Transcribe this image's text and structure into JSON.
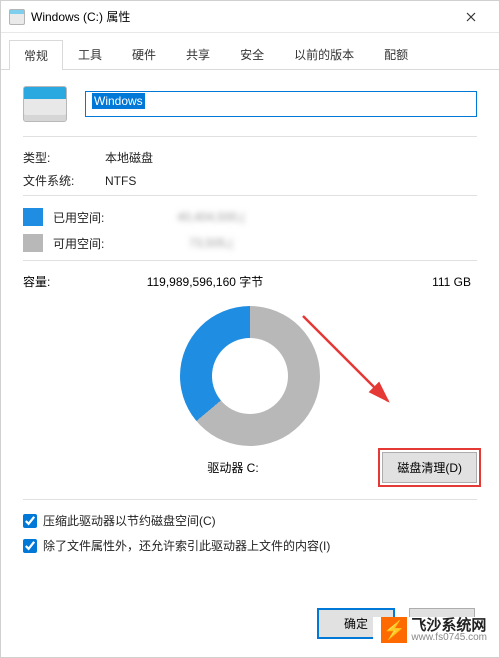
{
  "titlebar": {
    "title": "Windows (C:) 属性"
  },
  "tabs": [
    {
      "label": "常规",
      "active": true
    },
    {
      "label": "工具",
      "active": false
    },
    {
      "label": "硬件",
      "active": false
    },
    {
      "label": "共享",
      "active": false
    },
    {
      "label": "安全",
      "active": false
    },
    {
      "label": "以前的版本",
      "active": false
    },
    {
      "label": "配额",
      "active": false
    }
  ],
  "drive": {
    "name_value": "Windows",
    "type_label": "类型:",
    "type_value": "本地磁盘",
    "fs_label": "文件系统:",
    "fs_value": "NTFS"
  },
  "usage": {
    "used_label": "已用空间:",
    "used_bytes": "40,404,500,(",
    "used_gb": "",
    "free_label": "可用空间:",
    "free_bytes": "73,505,(",
    "free_gb": "",
    "capacity_label": "容量:",
    "capacity_bytes": "119,989,596,160 字节",
    "capacity_gb": "111 GB"
  },
  "chart_data": {
    "type": "pie",
    "title": "驱动器 C:",
    "series": [
      {
        "name": "已用空间",
        "color": "#1e8de2",
        "percent": 36
      },
      {
        "name": "可用空间",
        "color": "#b8b8b8",
        "percent": 64
      }
    ]
  },
  "buttons": {
    "cleanup": "磁盘清理(D)",
    "ok": "确定",
    "cancel": "取"
  },
  "checkboxes": {
    "compress": {
      "label": "压缩此驱动器以节约磁盘空间(C)",
      "checked": true
    },
    "index": {
      "label": "除了文件属性外，还允许索引此驱动器上文件的内容(I)",
      "checked": true
    }
  },
  "drive_label": "驱动器 C:",
  "watermark": {
    "name": "飞沙系统网",
    "url": "www.fs0745.com"
  }
}
